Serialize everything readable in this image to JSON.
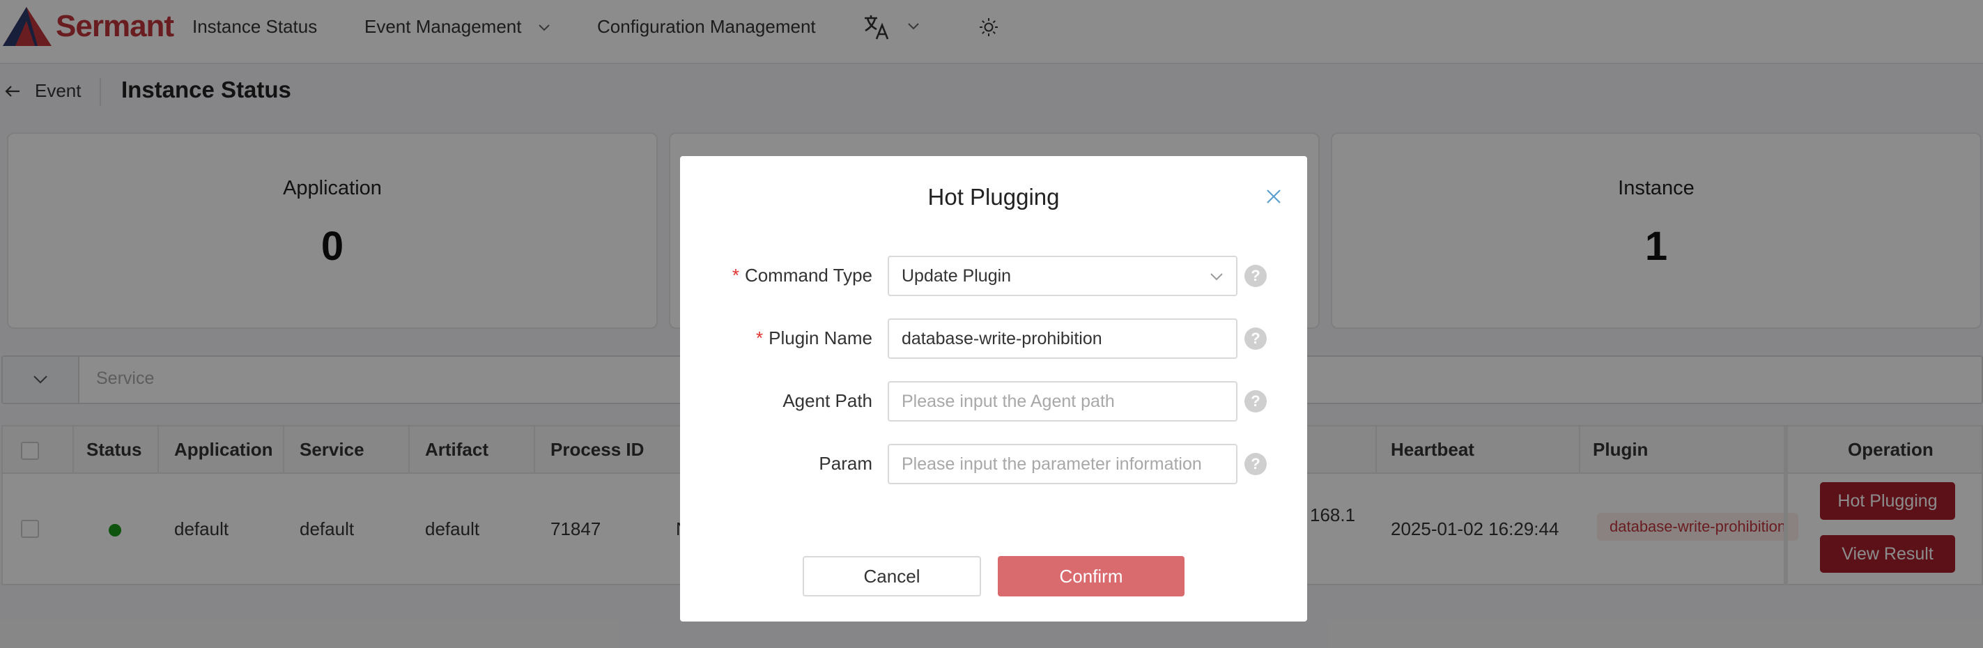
{
  "header": {
    "logo_text": "Sermant",
    "nav": {
      "instance_status": "Instance Status",
      "event_management": "Event Management",
      "configuration_management": "Configuration Management"
    },
    "icons": [
      "translate-icon",
      "chevron-down-icon",
      "sun-icon"
    ]
  },
  "breadcrumb": {
    "back_label": "Event",
    "title": "Instance Status"
  },
  "cards": {
    "application": {
      "label": "Application",
      "value": "0"
    },
    "instance": {
      "label": "Instance",
      "value": "1"
    }
  },
  "filter": {
    "placeholder": "Service"
  },
  "table": {
    "headers": {
      "status": "Status",
      "application": "Application",
      "service": "Service",
      "artifact": "Artifact",
      "process_id": "Process ID",
      "heartbeat": "Heartbeat",
      "plugin": "Plugin",
      "operation": "Operation"
    },
    "row": {
      "application": "default",
      "service": "default",
      "artifact": "default",
      "process_id": "71847",
      "partial_d": "N",
      "ip_partial": "168.1",
      "heartbeat": "2025-01-02 16:29:44",
      "plugin_tag": "database-write-prohibition",
      "hot_plugging_btn": "Hot Plugging",
      "view_result_btn": "View Result"
    }
  },
  "modal": {
    "title": "Hot Plugging",
    "fields": {
      "command_type": {
        "label": "Command Type",
        "required": "*",
        "value": "Update Plugin"
      },
      "plugin_name": {
        "label": "Plugin Name",
        "required": "*",
        "value": "database-write-prohibition"
      },
      "agent_path": {
        "label": "Agent Path",
        "placeholder": "Please input the Agent path"
      },
      "param": {
        "label": "Param",
        "placeholder": "Please input the parameter information"
      }
    },
    "help_glyph": "?",
    "cancel_label": "Cancel",
    "confirm_label": "Confirm"
  },
  "colors": {
    "brand": "#c2353b",
    "primary_button": "#a8202c",
    "confirm_disabled": "#d96b6f",
    "status_online": "#1a9a1a"
  }
}
